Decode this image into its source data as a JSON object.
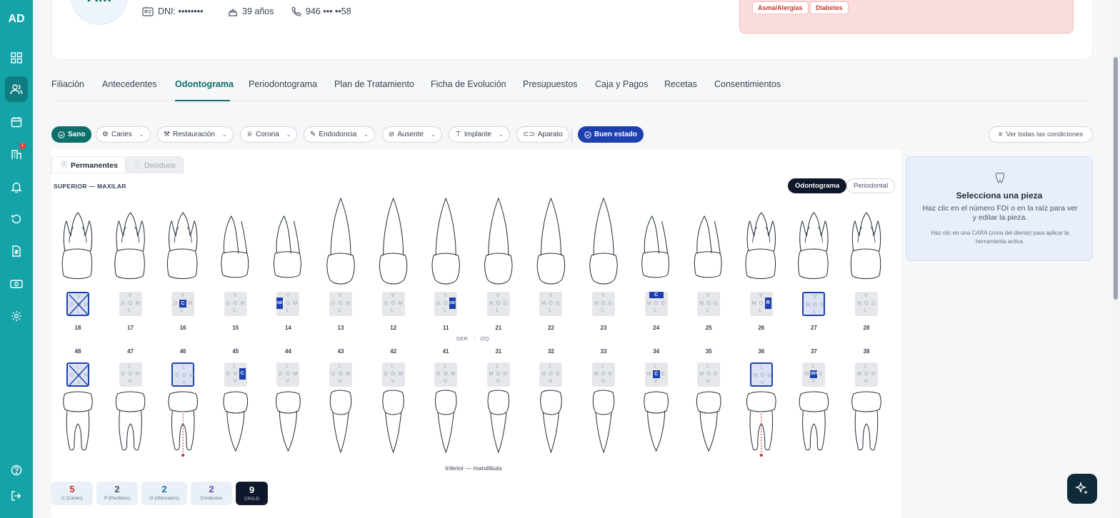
{
  "sidebar": {
    "logo": "AD",
    "badge": "1",
    "items": [
      "dashboard-icon",
      "patients-icon",
      "calendar-icon",
      "clinic-icon",
      "bell-icon",
      "history-icon",
      "invoice-icon",
      "cash-icon",
      "settings-icon"
    ],
    "bottom": [
      "help-icon",
      "logout-icon"
    ]
  },
  "patient": {
    "initials": "AM",
    "dni": "DNI: ••••••••",
    "age": "39 años",
    "phone": "946 ••• ••58",
    "alerts": [
      "Asma/Alergias",
      "Diabetes"
    ]
  },
  "tabs": [
    "Filiación",
    "Antecedentes",
    "Odontograma",
    "Periodontograma",
    "Plan de Tratamiento",
    "Ficha de Evolución",
    "Presupuestos",
    "Caja y Pagos",
    "Recetas",
    "Consentimientos"
  ],
  "active_tab": "Odontograma",
  "toolbar": {
    "tools": [
      "Sano",
      "Caries",
      "Restauración",
      "Corona",
      "Endodoncia",
      "Ausente",
      "Implante",
      "Aparato",
      "Buen estado"
    ],
    "view_all": "Ver todas las condiciones"
  },
  "chart": {
    "subtabs": [
      "Permanentes",
      "Deciduos"
    ],
    "upper_label": "SUPERIOR — MAXILAR",
    "view_modes": [
      "Odontograma",
      "Periodontal"
    ],
    "upper_teeth": [
      "18",
      "17",
      "16",
      "15",
      "14",
      "13",
      "12",
      "11",
      "21",
      "22",
      "23",
      "24",
      "25",
      "26",
      "27",
      "28"
    ],
    "lower_teeth": [
      "48",
      "47",
      "46",
      "45",
      "44",
      "43",
      "42",
      "41",
      "31",
      "32",
      "33",
      "34",
      "35",
      "36",
      "37",
      "38"
    ],
    "side_left": "DER",
    "side_right": "IZQ",
    "lower_label": "Inferior — mandíbula",
    "face_letters_upper": [
      "V",
      "D",
      "O",
      "M",
      "L"
    ],
    "face_letters_lower": [
      "L",
      "D",
      "O",
      "M",
      "V"
    ],
    "marks": {
      "caries": "C",
      "obturado": "OBT",
      "restauracion": "R"
    }
  },
  "stats": [
    {
      "value": "5",
      "label": "C (Caries)",
      "color": "#c53030"
    },
    {
      "value": "2",
      "label": "P (Perdidos)",
      "color": "#4b5563"
    },
    {
      "value": "2",
      "label": "O (Obturados)",
      "color": "#0d7a9a"
    },
    {
      "value": "2",
      "label": "Conductos",
      "color": "#6b46c1"
    },
    {
      "value": "9",
      "label": "CPO-D",
      "color": "#ffffff"
    }
  ],
  "panel": {
    "title": "Selecciona una pieza",
    "text1": "Haz clic en el número FDI o en la raíz para ver y editar la pieza.",
    "text2": "Haz clic en una CARA (zona del diente) para aplicar la herramienta activa."
  },
  "colors": {
    "teal": "#13a3a8",
    "accent": "#1e40af",
    "alert_bg": "#fbdcdc"
  }
}
